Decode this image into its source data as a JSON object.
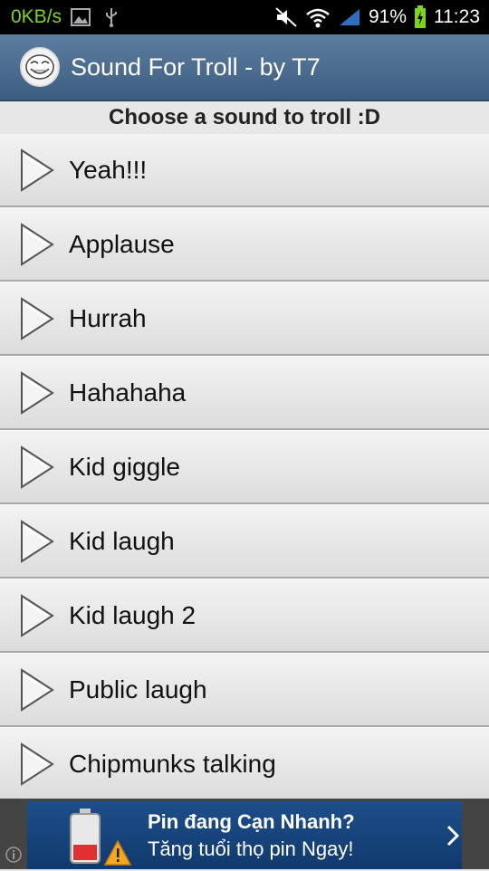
{
  "status_bar": {
    "net_speed": "0KB/s",
    "battery_percent": "91%",
    "time": "11:23",
    "icons": [
      "image-icon",
      "usb-icon",
      "mute-icon",
      "wifi-icon",
      "signal-icon",
      "battery-charging-icon"
    ]
  },
  "action_bar": {
    "title": "Sound For Troll - by T7",
    "icon": "troll-face-icon"
  },
  "header": "Choose a sound to troll :D",
  "sounds": [
    {
      "label": "Yeah!!!"
    },
    {
      "label": "Applause"
    },
    {
      "label": "Hurrah"
    },
    {
      "label": "Hahahaha"
    },
    {
      "label": "Kid giggle"
    },
    {
      "label": "Kid laugh"
    },
    {
      "label": "Kid laugh 2"
    },
    {
      "label": "Public laugh"
    },
    {
      "label": "Chipmunks talking"
    }
  ],
  "ad": {
    "line1": "Pin đang Cạn Nhanh?",
    "line2": "Tăng tuổi thọ pin Ngay!",
    "icon": "low-battery-warning-icon"
  },
  "colors": {
    "net_speed": "#7ed321",
    "action_bar": "#4a6b8f",
    "ad_background": "#154480"
  }
}
